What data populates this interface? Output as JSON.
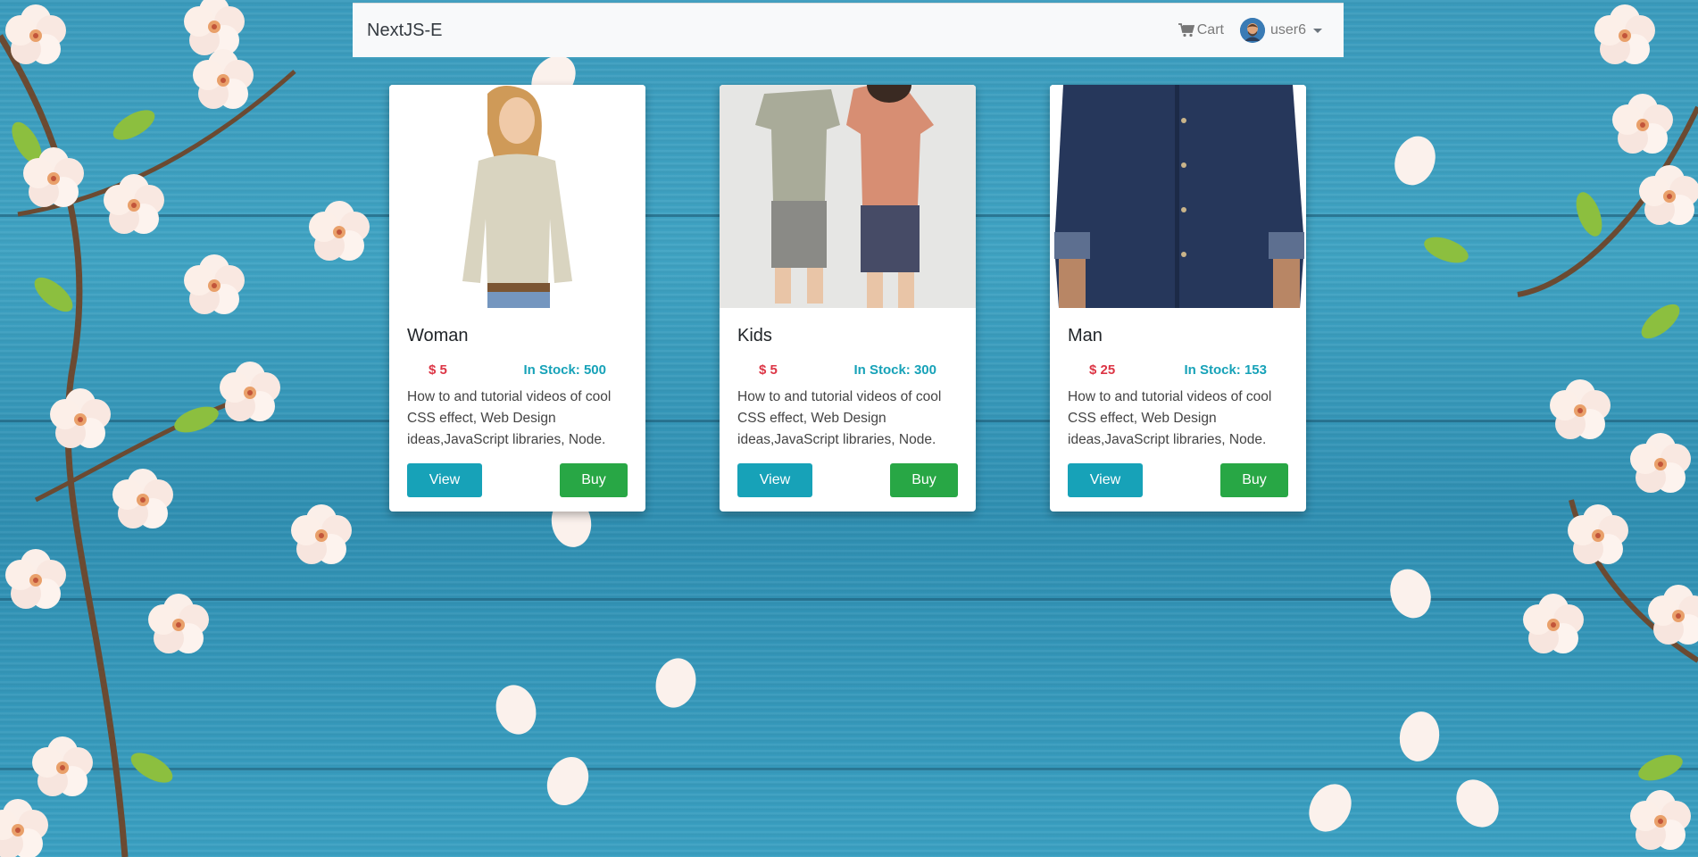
{
  "navbar": {
    "brand": "NextJS-E",
    "cart_label": "Cart",
    "user_label": "user6"
  },
  "products": [
    {
      "title": "Woman",
      "price": "$ 5",
      "stock": "In Stock: 500",
      "description": "How to and tutorial videos of cool CSS effect, Web Design ideas,JavaScript libraries, Node.",
      "view_label": "View",
      "buy_label": "Buy"
    },
    {
      "title": "Kids",
      "price": "$ 5",
      "stock": "In Stock: 300",
      "description": "How to and tutorial videos of cool CSS effect, Web Design ideas,JavaScript libraries, Node.",
      "view_label": "View",
      "buy_label": "Buy"
    },
    {
      "title": "Man",
      "price": "$ 25",
      "stock": "In Stock: 153",
      "description": "How to and tutorial videos of cool CSS effect, Web Design ideas,JavaScript libraries, Node.",
      "view_label": "View",
      "buy_label": "Buy"
    }
  ],
  "colors": {
    "price": "#dc3545",
    "stock": "#17a2b8",
    "view_button": "#17a2b8",
    "buy_button": "#28a745",
    "navbar_bg": "#f8f9fa"
  },
  "icons": [
    "cart-icon",
    "user-avatar",
    "dropdown-caret-icon"
  ]
}
